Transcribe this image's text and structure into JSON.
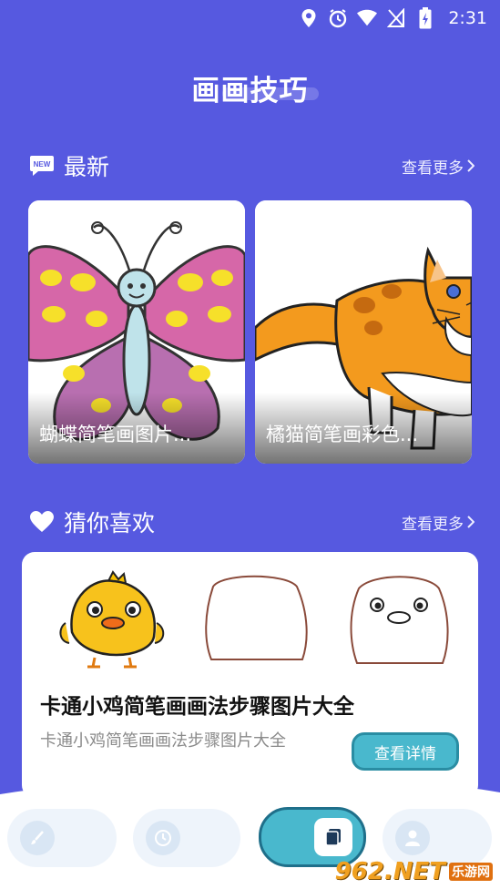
{
  "status": {
    "time": "2:31"
  },
  "page": {
    "title": "画画技巧"
  },
  "latest": {
    "section_title": "最新",
    "more_label": "查看更多",
    "badge": "NEW",
    "cards": [
      {
        "caption": "蝴蝶简笔画图片..."
      },
      {
        "caption": "橘猫简笔画彩色..."
      }
    ]
  },
  "recommend": {
    "section_title": "猜你喜欢",
    "more_label": "查看更多",
    "item": {
      "title": "卡通小鸡简笔画画法步骤图片大全",
      "description": "卡通小鸡简笔画画法步骤图片大全",
      "button_label": "查看详情"
    }
  },
  "nav": {
    "items": [
      {
        "icon": "brush-icon"
      },
      {
        "icon": "clock-icon"
      },
      {
        "icon": "copy-icon",
        "active": true
      },
      {
        "icon": "user-icon"
      }
    ]
  },
  "watermark": {
    "main": "962.NET",
    "sub": "乐游网"
  },
  "colors": {
    "background": "#5659e0",
    "accent": "#49b8cd"
  }
}
